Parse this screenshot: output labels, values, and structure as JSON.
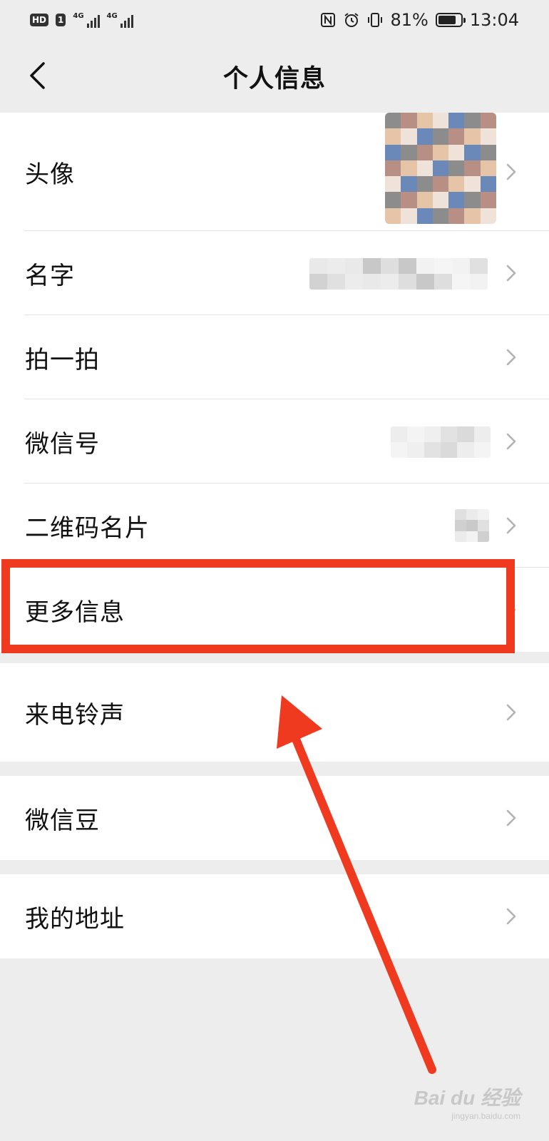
{
  "status_bar": {
    "hd_badge": "HD",
    "sim_badge": "1",
    "network1": "4G",
    "network2": "4G",
    "battery_percent": "81%",
    "battery_level": 0.81,
    "time": "13:04"
  },
  "header": {
    "title": "个人信息"
  },
  "group1": {
    "items": [
      {
        "label": "头像"
      },
      {
        "label": "名字"
      },
      {
        "label": "拍一拍"
      },
      {
        "label": "微信号"
      },
      {
        "label": "二维码名片"
      },
      {
        "label": "更多信息"
      }
    ]
  },
  "group2": {
    "items": [
      {
        "label": "来电铃声"
      }
    ]
  },
  "group3": {
    "items": [
      {
        "label": "微信豆"
      }
    ]
  },
  "group4": {
    "items": [
      {
        "label": "我的地址"
      }
    ]
  },
  "annotation": {
    "highlight_color": "#f03a1f",
    "arrow_color": "#f03a1f"
  },
  "watermark": {
    "logo": "Bai du 经验",
    "url": "jingyan.baidu.com"
  },
  "colors": {
    "background": "#ededed",
    "row_background": "#ffffff",
    "chevron": "#b2b2b2"
  }
}
